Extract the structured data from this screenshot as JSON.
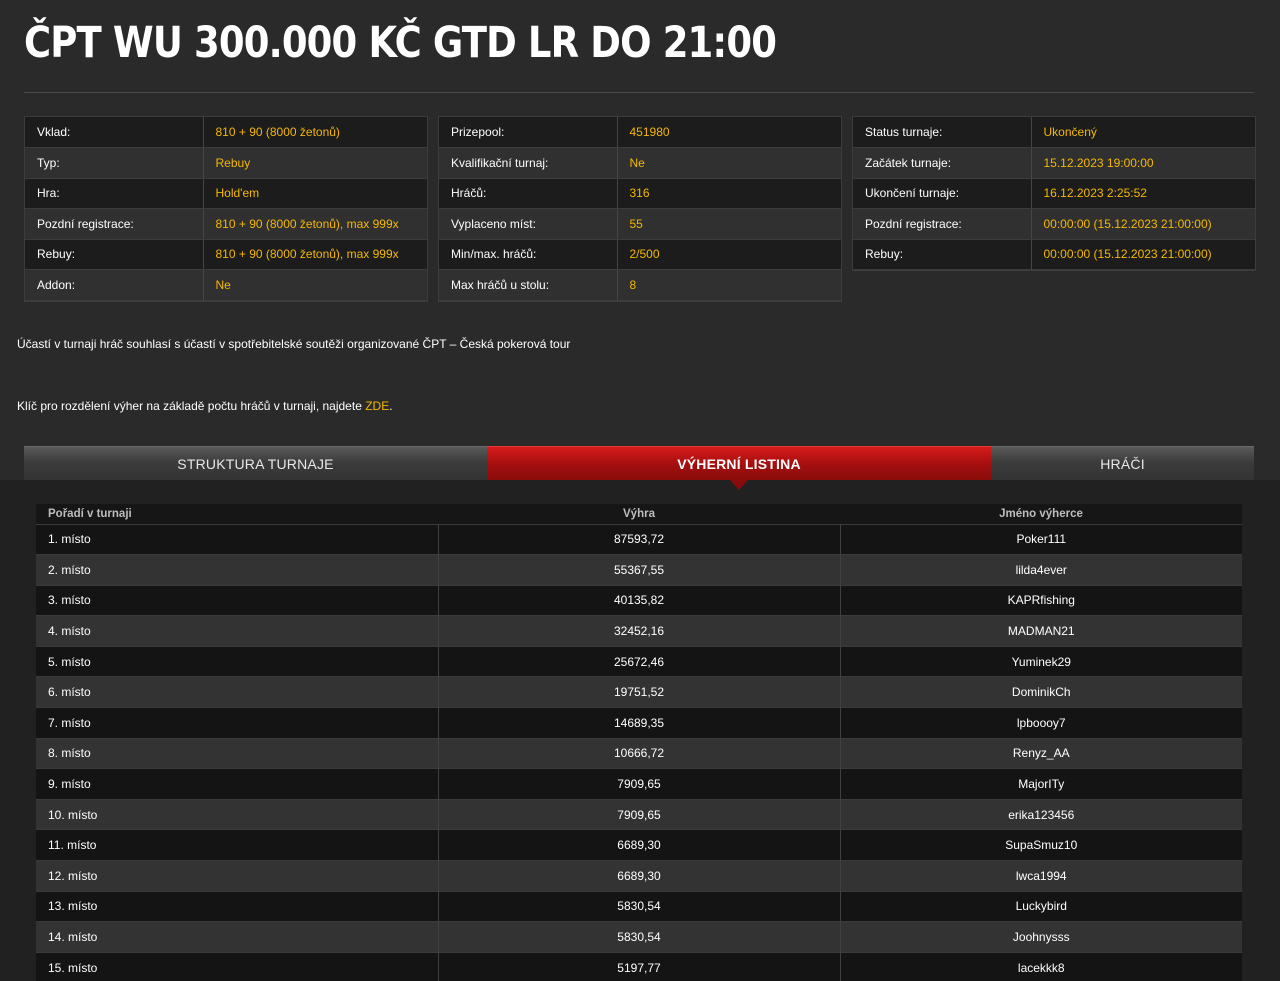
{
  "page": {
    "title": "ČPT WU 300.000 KČ GTD LR DO 21:00"
  },
  "info": {
    "col1": [
      {
        "label": "Vklad:",
        "value": "810 + 90 (8000 žetonů)"
      },
      {
        "label": "Typ:",
        "value": "Rebuy"
      },
      {
        "label": "Hra:",
        "value": "Hold'em"
      },
      {
        "label": "Pozdní registrace:",
        "value": "810 + 90 (8000 žetonů), max 999x"
      },
      {
        "label": "Rebuy:",
        "value": "810 + 90 (8000 žetonů), max 999x"
      },
      {
        "label": "Addon:",
        "value": "Ne"
      }
    ],
    "col2": [
      {
        "label": "Prizepool:",
        "value": "451980"
      },
      {
        "label": "Kvalifikační turnaj:",
        "value": "Ne"
      },
      {
        "label": "Hráčů:",
        "value": "316"
      },
      {
        "label": "Vyplaceno míst:",
        "value": "55"
      },
      {
        "label": "Min/max. hráčů:",
        "value": "2/500"
      },
      {
        "label": "Max hráčů u stolu:",
        "value": "8"
      }
    ],
    "col3": [
      {
        "label": "Status turnaje:",
        "value": "Ukončený"
      },
      {
        "label": "Začátek turnaje:",
        "value": "15.12.2023 19:00:00"
      },
      {
        "label": "Ukončení turnaje:",
        "value": "16.12.2023 2:25:52"
      },
      {
        "label": "Pozdní registrace:",
        "value": "00:00:00 (15.12.2023 21:00:00)"
      },
      {
        "label": "Rebuy:",
        "value": "00:00:00 (15.12.2023 21:00:00)"
      }
    ]
  },
  "notices": {
    "consent": "Účastí v turnaji hráč souhlasí s účastí v spotřebitelské soutěži organizované ČPT – Česká pokerová tour",
    "key_text": "Klíč pro rozdělení výher na základě počtu hráčů v turnaji, najdete ",
    "key_link": "ZDE",
    "key_end": "."
  },
  "tabs": [
    {
      "label": "STRUKTURA TURNAJE",
      "active": false
    },
    {
      "label": "VÝHERNÍ LISTINA",
      "active": true
    },
    {
      "label": "HRÁČI",
      "active": false
    }
  ],
  "results": {
    "headers": [
      "Pořadí v turnaji",
      "Výhra",
      "Jméno výherce"
    ],
    "rows": [
      [
        "1. místo",
        "87593,72",
        "Poker111"
      ],
      [
        "2. místo",
        "55367,55",
        "lilda4ever"
      ],
      [
        "3. místo",
        "40135,82",
        "KAPRfishing"
      ],
      [
        "4. místo",
        "32452,16",
        "MADMAN21"
      ],
      [
        "5. místo",
        "25672,46",
        "Yuminek29"
      ],
      [
        "6. místo",
        "19751,52",
        "DominikCh"
      ],
      [
        "7. místo",
        "14689,35",
        "lpboooy7"
      ],
      [
        "8. místo",
        "10666,72",
        "Renyz_AA"
      ],
      [
        "9. místo",
        "7909,65",
        "MajorITy"
      ],
      [
        "10. místo",
        "7909,65",
        "erika123456"
      ],
      [
        "11. místo",
        "6689,30",
        "SupaSmuz10"
      ],
      [
        "12. místo",
        "6689,30",
        "lwca1994"
      ],
      [
        "13. místo",
        "5830,54",
        "Luckybird"
      ],
      [
        "14. místo",
        "5830,54",
        "Joohnysss"
      ],
      [
        "15. místo",
        "5197,77",
        "lacekkk8"
      ]
    ]
  },
  "colors": {
    "accent": "#f5b800",
    "active_tab": "#c01414",
    "background": "#2a2a2a"
  }
}
